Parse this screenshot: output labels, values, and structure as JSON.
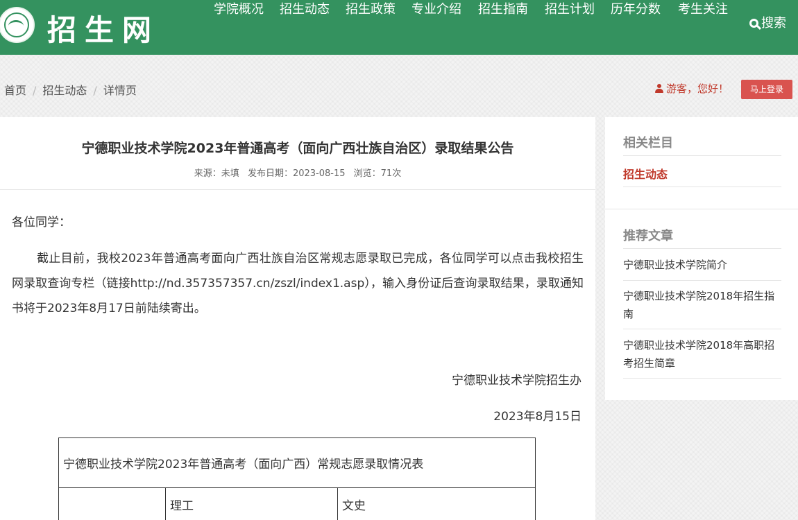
{
  "header": {
    "site_title": "招生网",
    "nav": [
      "学院概况",
      "招生动态",
      "招生政策",
      "专业介绍",
      "招生指南",
      "招生计划",
      "历年分数",
      "考生关注"
    ],
    "search_label": "搜索",
    "brand_color": "#34925f"
  },
  "breadcrumb": [
    "首页",
    "招生动态",
    "详情页"
  ],
  "user": {
    "greeting": "游客，您好！",
    "login_label": "马上登录"
  },
  "article": {
    "title": "宁德职业技术学院2023年普通高考（面向广西壮族自治区）录取结果公告",
    "source": "来源：未填",
    "date": "发布日期：2023-08-15",
    "views": "浏览：71次",
    "greeting": "各位同学：",
    "body": "截止目前，我校2023年普通高考面向广西壮族自治区常规志愿录取已完成，各位同学可以点击我校招生网录取查询专栏（链接http://nd.357357357.cn/zszl/index1.asp），输入身份证后查询录取结果，录取通知书将于2023年8月17日前陆续寄出。",
    "signature": "宁德职业技术学院招生办",
    "sign_date": "2023年8月15日",
    "table": {
      "caption": "宁德职业技术学院2023年普通高考（面向广西）常规志愿录取情况表",
      "headers": [
        "",
        "理工",
        "文史"
      ]
    }
  },
  "sidebar": {
    "related_title": "相关栏目",
    "related_active": "招生动态",
    "recommend_title": "推荐文章",
    "recommend": [
      "宁德职业技术学院简介",
      "宁德职业技术学院2018年招生指南",
      "宁德职业技术学院2018年高职招考招生简章"
    ]
  }
}
